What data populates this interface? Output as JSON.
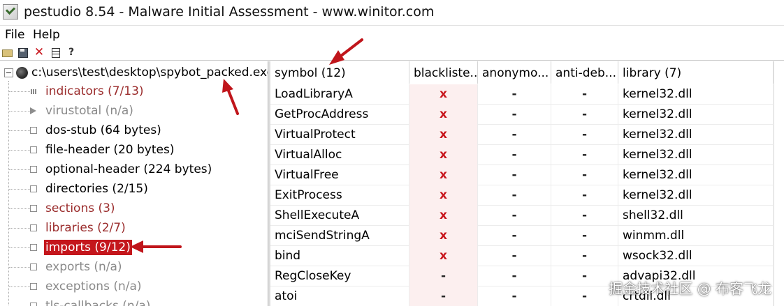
{
  "window": {
    "title": "pestudio 8.54 - Malware Initial Assessment - www.winitor.com"
  },
  "menu": {
    "file": "File",
    "help": "Help"
  },
  "toolbar": {
    "icons": [
      "open-icon",
      "save-icon",
      "close-icon",
      "document-icon",
      "help-icon"
    ]
  },
  "tree": {
    "root_label": "c:\\users\\test\\desktop\\spybot_packed.exe",
    "items": [
      {
        "label": "indicators (7/13)",
        "icon": "bars",
        "tone": "red"
      },
      {
        "label": "virustotal (n/a)",
        "icon": "play",
        "tone": "gray"
      },
      {
        "label": "dos-stub (64 bytes)",
        "icon": "box",
        "tone": "black"
      },
      {
        "label": "file-header (20 bytes)",
        "icon": "box",
        "tone": "black"
      },
      {
        "label": "optional-header (224 bytes)",
        "icon": "box",
        "tone": "black"
      },
      {
        "label": "directories (2/15)",
        "icon": "box",
        "tone": "black"
      },
      {
        "label": "sections (3)",
        "icon": "box",
        "tone": "red"
      },
      {
        "label": "libraries (2/7)",
        "icon": "box",
        "tone": "red"
      },
      {
        "label": "imports (9/12)",
        "icon": "box",
        "tone": "selected"
      },
      {
        "label": "exports (n/a)",
        "icon": "box",
        "tone": "gray"
      },
      {
        "label": "exceptions (n/a)",
        "icon": "box",
        "tone": "gray"
      },
      {
        "label": "tls-callbacks (n/a)",
        "icon": "box",
        "tone": "gray"
      }
    ]
  },
  "grid": {
    "columns": [
      "symbol (12)",
      "blackliste...",
      "anonymo...",
      "anti-deb...",
      "library (7)"
    ],
    "rows": [
      {
        "symbol": "LoadLibraryA",
        "blacklisted": "x",
        "anonymous": "-",
        "antidebug": "-",
        "library": "kernel32.dll"
      },
      {
        "symbol": "GetProcAddress",
        "blacklisted": "x",
        "anonymous": "-",
        "antidebug": "-",
        "library": "kernel32.dll"
      },
      {
        "symbol": "VirtualProtect",
        "blacklisted": "x",
        "anonymous": "-",
        "antidebug": "-",
        "library": "kernel32.dll"
      },
      {
        "symbol": "VirtualAlloc",
        "blacklisted": "x",
        "anonymous": "-",
        "antidebug": "-",
        "library": "kernel32.dll"
      },
      {
        "symbol": "VirtualFree",
        "blacklisted": "x",
        "anonymous": "-",
        "antidebug": "-",
        "library": "kernel32.dll"
      },
      {
        "symbol": "ExitProcess",
        "blacklisted": "x",
        "anonymous": "-",
        "antidebug": "-",
        "library": "kernel32.dll"
      },
      {
        "symbol": "ShellExecuteA",
        "blacklisted": "x",
        "anonymous": "-",
        "antidebug": "-",
        "library": "shell32.dll"
      },
      {
        "symbol": "mciSendStringA",
        "blacklisted": "x",
        "anonymous": "-",
        "antidebug": "-",
        "library": "winmm.dll"
      },
      {
        "symbol": "bind",
        "blacklisted": "x",
        "anonymous": "-",
        "antidebug": "-",
        "library": "wsock32.dll"
      },
      {
        "symbol": "RegCloseKey",
        "blacklisted": "-",
        "anonymous": "-",
        "antidebug": "-",
        "library": "advapi32.dll"
      },
      {
        "symbol": "atoi",
        "blacklisted": "-",
        "anonymous": "-",
        "antidebug": "-",
        "library": "crtdll.dll"
      }
    ]
  },
  "colors": {
    "selection": "#c4161c",
    "flag_red": "#c8161d",
    "annotation_arrow": "#c0151b",
    "label_red": "#9b2d2d",
    "label_gray": "#8a8a8a"
  },
  "watermark": "掘金技术社区 @ 布客飞龙"
}
